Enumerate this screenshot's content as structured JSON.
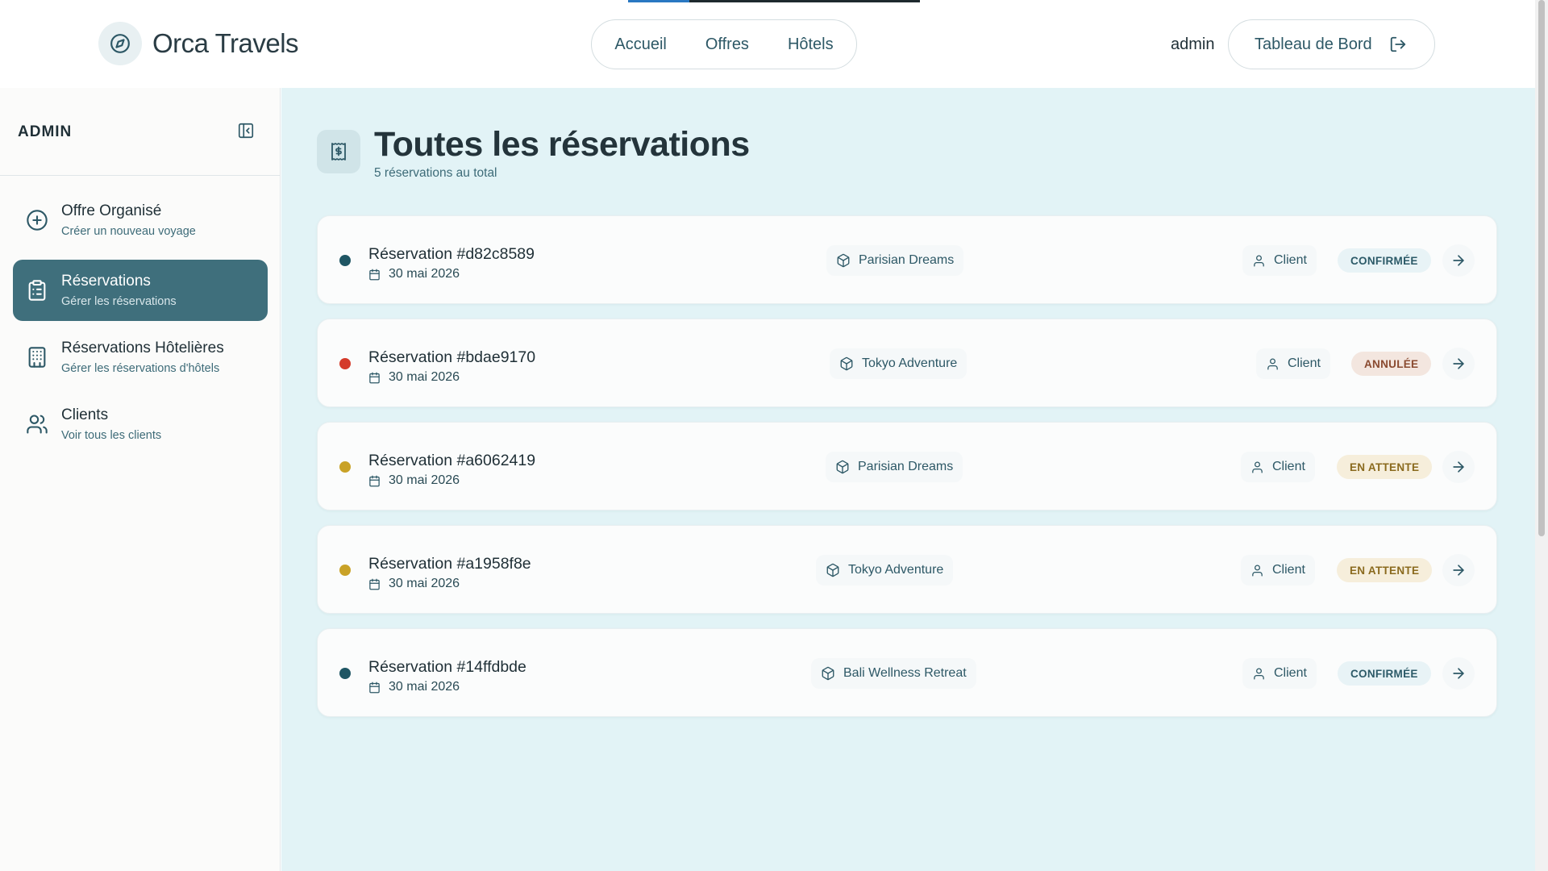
{
  "header": {
    "brand": "Orca Travels",
    "nav": [
      "Accueil",
      "Offres",
      "Hôtels"
    ],
    "user": "admin",
    "dashboard_label": "Tableau de Bord",
    "loading_progress": 0.21
  },
  "sidebar": {
    "title": "ADMIN",
    "items": [
      {
        "label": "Offre Organisé",
        "sub": "Créer un nouveau voyage",
        "icon": "plus-circle-icon",
        "active": false
      },
      {
        "label": "Réservations",
        "sub": "Gérer les réservations",
        "icon": "clipboard-list-icon",
        "active": true
      },
      {
        "label": "Réservations Hôtelières",
        "sub": "Gérer les réservations d'hôtels",
        "icon": "building-icon",
        "active": false
      },
      {
        "label": "Clients",
        "sub": "Voir tous les clients",
        "icon": "users-icon",
        "active": false
      }
    ]
  },
  "main": {
    "title": "Toutes les réservations",
    "subtitle": "5 réservations au total",
    "reservations": [
      {
        "title": "Réservation #d82c8589",
        "date": "30 mai 2026",
        "offer": "Parisian Dreams",
        "client": "Client",
        "status": "CONFIRMÉE",
        "status_type": "confirmed",
        "dot_color": "#1f5664"
      },
      {
        "title": "Réservation #bdae9170",
        "date": "30 mai 2026",
        "offer": "Tokyo Adventure",
        "client": "Client",
        "status": "ANNULÉE",
        "status_type": "cancelled",
        "dot_color": "#d43a2a"
      },
      {
        "title": "Réservation #a6062419",
        "date": "30 mai 2026",
        "offer": "Parisian Dreams",
        "client": "Client",
        "status": "EN ATTENTE",
        "status_type": "pending",
        "dot_color": "#c9a227"
      },
      {
        "title": "Réservation #a1958f8e",
        "date": "30 mai 2026",
        "offer": "Tokyo Adventure",
        "client": "Client",
        "status": "EN ATTENTE",
        "status_type": "pending",
        "dot_color": "#c9a227"
      },
      {
        "title": "Réservation #14ffdbde",
        "date": "30 mai 2026",
        "offer": "Bali Wellness Retreat",
        "client": "Client",
        "status": "CONFIRMÉE",
        "status_type": "confirmed",
        "dot_color": "#1f5664"
      }
    ]
  }
}
